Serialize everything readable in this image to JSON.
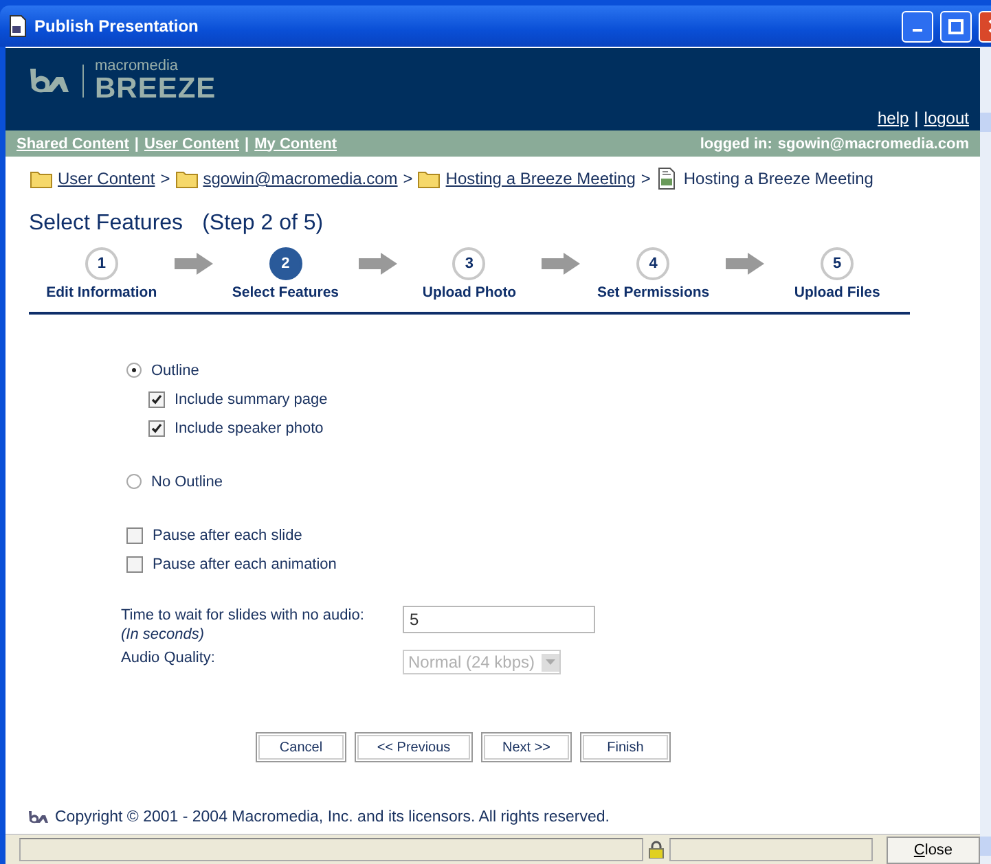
{
  "window": {
    "title": "Publish Presentation"
  },
  "header": {
    "brand": "macromedia",
    "product": "BREEZE",
    "links": [
      {
        "kind": "link",
        "label": "help"
      },
      {
        "kind": "separator",
        "label": "|"
      },
      {
        "kind": "link",
        "label": "logout"
      }
    ]
  },
  "nav": {
    "links": [
      {
        "kind": "link",
        "label": "Shared Content"
      },
      {
        "kind": "separator",
        "label": "|"
      },
      {
        "kind": "link",
        "label": "User Content"
      },
      {
        "kind": "separator",
        "label": "|"
      },
      {
        "kind": "link",
        "label": "My Content"
      }
    ],
    "logged_in_label": "logged in:",
    "user": "sgowin@macromedia.com"
  },
  "breadcrumb": [
    {
      "kind": "folder",
      "label": "User Content"
    },
    {
      "kind": "separator",
      "label": ">"
    },
    {
      "kind": "folder",
      "label": "sgowin@macromedia.com"
    },
    {
      "kind": "separator",
      "label": ">"
    },
    {
      "kind": "folder",
      "label": "Hosting a Breeze Meeting"
    },
    {
      "kind": "separator",
      "label": ">"
    },
    {
      "kind": "document",
      "label": "Hosting a Breeze Meeting"
    }
  ],
  "page_title": "Select Features",
  "step_label": "(Step 2 of 5)",
  "steps": [
    {
      "number": "1",
      "label": "Edit Information",
      "selected": false
    },
    {
      "number": "2",
      "label": "Select Features",
      "selected": true
    },
    {
      "number": "3",
      "label": "Upload Photo",
      "selected": false
    },
    {
      "number": "4",
      "label": "Set Permissions",
      "selected": false
    },
    {
      "number": "5",
      "label": "Upload Files",
      "selected": false
    }
  ],
  "outline_options": [
    {
      "label": "Outline",
      "selected": true,
      "children": [
        {
          "label": "Include summary page",
          "checked": true
        },
        {
          "label": "Include speaker photo",
          "checked": true
        }
      ]
    },
    {
      "label": "No Outline",
      "selected": false
    }
  ],
  "pause_options": [
    {
      "label": "Pause after each slide",
      "checked": false
    },
    {
      "label": "Pause after each animation",
      "checked": false
    }
  ],
  "wait_time": {
    "label": "Time to wait for slides with no audio:",
    "hint": "(In seconds)",
    "value": "5"
  },
  "audio_quality": {
    "label": "Audio Quality:",
    "value": "Normal (24 kbps)",
    "disabled": true
  },
  "buttons": [
    "Cancel",
    "<< Previous",
    "Next >>",
    "Finish"
  ],
  "copyright": "Copyright © 2001 - 2004 Macromedia, Inc. and its licensors. All rights reserved.",
  "status_bar": {
    "close_button": "Close"
  }
}
